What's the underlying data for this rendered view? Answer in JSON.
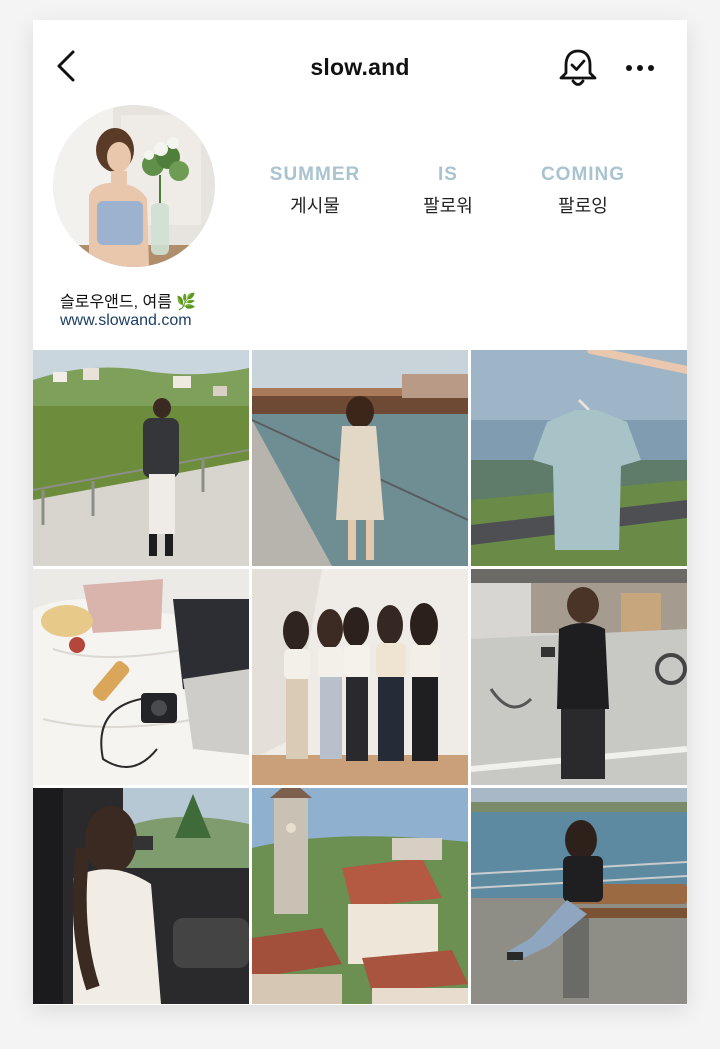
{
  "header": {
    "username": "slow.and",
    "back_icon": "chevron-left-icon",
    "bell_icon": "bell-check-icon",
    "more_icon": "more-horizontal-icon"
  },
  "profile": {
    "stats": [
      {
        "value": "SUMMER",
        "label": "게시물"
      },
      {
        "value": "IS",
        "label": "팔로워"
      },
      {
        "value": "COMING",
        "label": "팔로잉"
      }
    ],
    "bio_name": "슬로우앤드, 여름 🌿",
    "bio_link": "www.slowand.com",
    "stat_color": "#a9c3cf",
    "link_color": "#1e3f66"
  },
  "grid": {
    "posts": [
      {
        "icon": "photo-woman-field"
      },
      {
        "icon": "photo-woman-bridge"
      },
      {
        "icon": "photo-blue-tshirt"
      },
      {
        "icon": "photo-bed-flatlay"
      },
      {
        "icon": "photo-four-women"
      },
      {
        "icon": "photo-woman-camera-street"
      },
      {
        "icon": "photo-woman-car"
      },
      {
        "icon": "photo-old-town-roofs"
      },
      {
        "icon": "photo-woman-bench-lake"
      }
    ]
  }
}
